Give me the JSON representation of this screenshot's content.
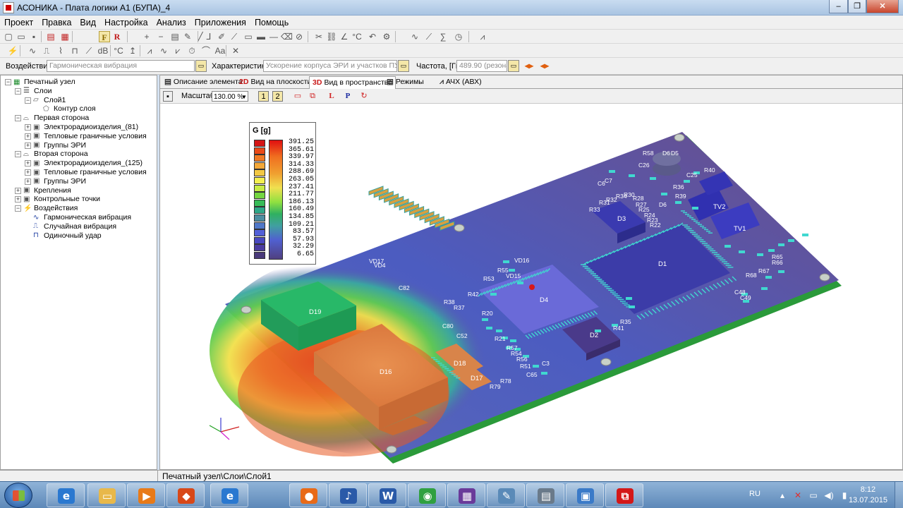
{
  "window": {
    "title": "АСОНИКА - Плата логики А1 (БУПА)_4"
  },
  "menu": [
    "Проект",
    "Правка",
    "Вид",
    "Настройка",
    "Анализ",
    "Приложения",
    "Помощь"
  ],
  "params": {
    "impact_label": "Воздействие",
    "impact_value": "Гармоническая вибрация",
    "characteristic_label": "Характеристика",
    "characteristic_value": "Ускорение корпуса ЭРИ и участков ПУ",
    "frequency_label": "Частота, [Гц]",
    "frequency_value": "489.90 (резонанс"
  },
  "tree": [
    {
      "label": "Печатный узел",
      "level": 0,
      "exp": "-",
      "icon": "board-icon"
    },
    {
      "label": "Слои",
      "level": 1,
      "exp": "-",
      "icon": "layers-icon"
    },
    {
      "label": "Слой1",
      "level": 2,
      "exp": "-",
      "icon": "layer-icon"
    },
    {
      "label": "Контур слоя",
      "level": 3,
      "exp": "",
      "icon": "contour-icon"
    },
    {
      "label": "Первая сторона",
      "level": 1,
      "exp": "-",
      "icon": "side-icon"
    },
    {
      "label": "Электрорадиоизделия_(81)",
      "level": 2,
      "exp": "+",
      "icon": "component-icon"
    },
    {
      "label": "Тепловые граничные условия",
      "level": 2,
      "exp": "+",
      "icon": "component-icon"
    },
    {
      "label": "Группы ЭРИ",
      "level": 2,
      "exp": "+",
      "icon": "component-icon"
    },
    {
      "label": "Вторая сторона",
      "level": 1,
      "exp": "-",
      "icon": "side-icon"
    },
    {
      "label": "Электрорадиоизделия_(125)",
      "level": 2,
      "exp": "+",
      "icon": "component-icon"
    },
    {
      "label": "Тепловые граничные условия",
      "level": 2,
      "exp": "+",
      "icon": "component-icon"
    },
    {
      "label": "Группы ЭРИ",
      "level": 2,
      "exp": "+",
      "icon": "component-icon"
    },
    {
      "label": "Крепления",
      "level": 1,
      "exp": "+",
      "icon": "component-icon"
    },
    {
      "label": "Контрольные точки",
      "level": 1,
      "exp": "+",
      "icon": "component-icon"
    },
    {
      "label": "Воздействия",
      "level": 1,
      "exp": "-",
      "icon": "lightning-icon"
    },
    {
      "label": "Гармоническая вибрация",
      "level": 2,
      "exp": "",
      "icon": "sine-wave-icon"
    },
    {
      "label": "Случайная вибрация",
      "level": 2,
      "exp": "",
      "icon": "random-wave-icon"
    },
    {
      "label": "Одиночный удар",
      "level": 2,
      "exp": "",
      "icon": "pulse-icon"
    }
  ],
  "tabs": [
    {
      "label": "Описание элемента",
      "icon": "document-icon",
      "glyph": "▤"
    },
    {
      "label": "Вид на плоскости",
      "icon": "2d-icon",
      "glyph": "2D"
    },
    {
      "label": "Вид в пространстве",
      "icon": "3d-icon",
      "glyph": "3D"
    },
    {
      "label": "Режимы",
      "icon": "document-icon",
      "glyph": "▤"
    },
    {
      "label": "АЧХ (АВХ)",
      "icon": "graph-icon",
      "glyph": "⩘"
    }
  ],
  "active_tab": 2,
  "viewbar": {
    "scale_label": "Масштаб",
    "scale_value": "130.00 %",
    "btn1": "1",
    "btn2": "2",
    "btn_l": "L",
    "btn_p": "P"
  },
  "legend": {
    "title": "G [g]",
    "values": [
      "391.25",
      "365.61",
      "339.97",
      "314.33",
      "288.69",
      "263.05",
      "237.41",
      "211.77",
      "186.13",
      "160.49",
      "134.85",
      "109.21",
      "83.57",
      "57.93",
      "32.29",
      "6.65"
    ],
    "colors": [
      "#d41515",
      "#ea4a18",
      "#f07a25",
      "#f4a838",
      "#f2c844",
      "#f4f050",
      "#c8ec44",
      "#74d640",
      "#38bc58",
      "#2ea888",
      "#4c8ea0",
      "#5078c8",
      "#5260d8",
      "#4848c0",
      "#4a3ca0",
      "#4a3a7a"
    ]
  },
  "board": {
    "labels": [
      "R58",
      "D6",
      "D5",
      "C26",
      "C25",
      "R40",
      "C6",
      "C7",
      "R36",
      "R39",
      "D6",
      "TV2",
      "R30",
      "R28",
      "R27",
      "R25",
      "R24",
      "R23",
      "R22",
      "R31",
      "R32",
      "R34",
      "R33",
      "D3",
      "TV1",
      "D1",
      "R65",
      "R66",
      "R67",
      "R68",
      "C48",
      "C49",
      "VD16",
      "R55",
      "VD15",
      "R53",
      "R42",
      "D4",
      "R35",
      "R41",
      "D2",
      "R57",
      "R54",
      "R56",
      "C3",
      "R51",
      "C65",
      "R78",
      "R79",
      "VD17",
      "D19",
      "D16",
      "D18",
      "D17",
      "VD4",
      "C82",
      "C80",
      "C52",
      "R38",
      "R37",
      "R21",
      "R20"
    ]
  },
  "status": {
    "path": "Печатный узел\\Слои\\Слой1"
  },
  "taskbar": {
    "apps": [
      {
        "name": "internet-explorer-icon",
        "glyph": "e",
        "color": "#2a78d0"
      },
      {
        "name": "explorer-folder-icon",
        "glyph": "▭",
        "color": "#e8b84a"
      },
      {
        "name": "media-player-icon",
        "glyph": "▶",
        "color": "#e87a18"
      },
      {
        "name": "asonika-icon",
        "glyph": "◆",
        "color": "#d84818"
      },
      {
        "name": "internet-explorer-icon",
        "glyph": "e",
        "color": "#2a78d0"
      },
      {
        "name": "firefox-icon",
        "glyph": "●",
        "color": "#e86a18"
      },
      {
        "name": "sound-icon",
        "glyph": "♪",
        "color": "#2a5aa8"
      },
      {
        "name": "word-icon",
        "glyph": "W",
        "color": "#2a5aa8"
      },
      {
        "name": "chrome-icon",
        "glyph": "◉",
        "color": "#30a040"
      },
      {
        "name": "save-floppy-icon",
        "glyph": "▦",
        "color": "#6a3a9a"
      },
      {
        "name": "notepad-icon",
        "glyph": "✎",
        "color": "#5a8ab8"
      },
      {
        "name": "calculator-icon",
        "glyph": "▤",
        "color": "#6a7a8a"
      },
      {
        "name": "network-app-icon",
        "glyph": "▣",
        "color": "#3a7ac8"
      },
      {
        "name": "asonika-red-icon",
        "glyph": "⧉",
        "color": "#d41818"
      }
    ],
    "lang": "RU",
    "time": "8:12",
    "date": "13.07.2015"
  }
}
